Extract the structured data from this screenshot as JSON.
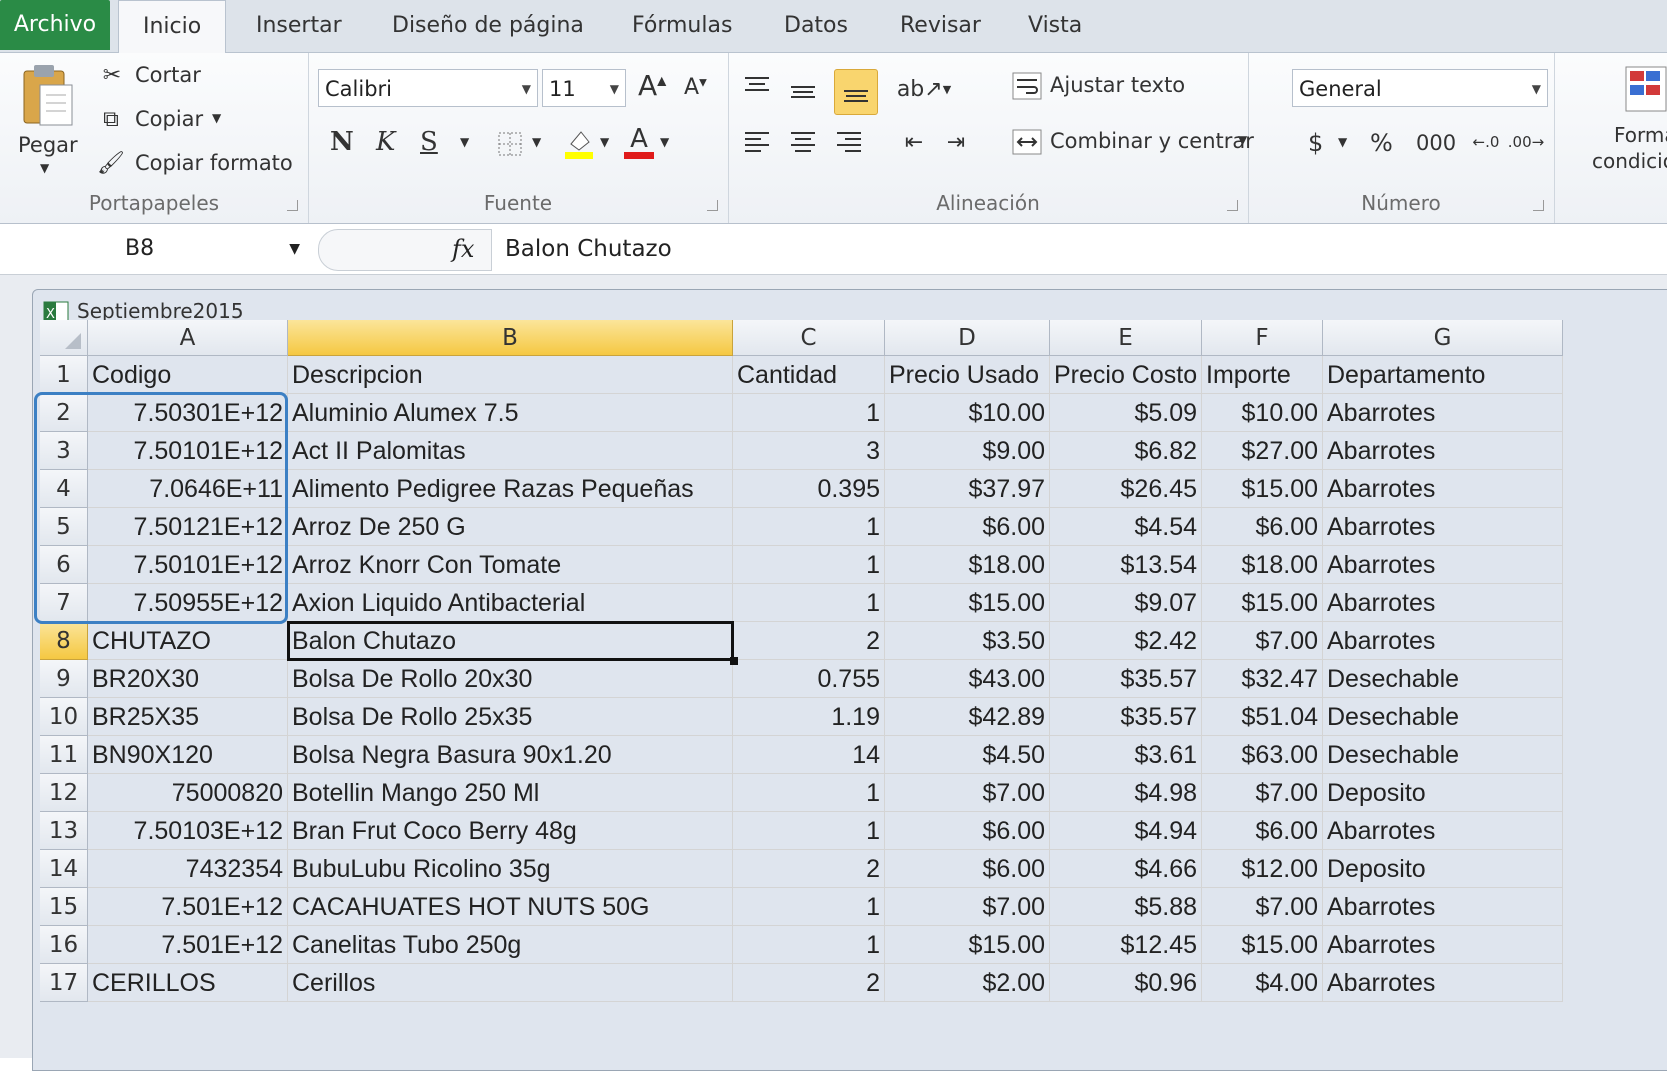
{
  "tabs": {
    "file": "Archivo",
    "items": [
      "Inicio",
      "Insertar",
      "Diseño de página",
      "Fórmulas",
      "Datos",
      "Revisar",
      "Vista"
    ]
  },
  "ribbon": {
    "clipboard": {
      "paste": "Pegar",
      "cut": "Cortar",
      "copy": "Copiar",
      "format_painter": "Copiar formato",
      "label": "Portapapeles"
    },
    "font": {
      "name": "Calibri",
      "size": "11",
      "bold": "N",
      "italic": "K",
      "underline": "S",
      "grow": "A",
      "shrink": "A",
      "font_color": "A",
      "label": "Fuente"
    },
    "alignment": {
      "wrap": "Ajustar texto",
      "merge": "Combinar y centrar",
      "label": "Alineación"
    },
    "number": {
      "format": "General",
      "currency": "$",
      "percent": "%",
      "thousands": "000",
      "label": "Número"
    },
    "styles": {
      "cond_format_1": "Forma",
      "cond_format_2": "condicio"
    }
  },
  "formula_bar": {
    "name_box": "B8",
    "fx": "fx",
    "value": "Balon Chutazo"
  },
  "workbook": {
    "title": "Septiembre2015"
  },
  "sheet": {
    "columns": [
      "A",
      "B",
      "C",
      "D",
      "E",
      "F",
      "G"
    ],
    "selected_column": "B",
    "selected_row": "8",
    "rows": [
      {
        "n": "1",
        "a": "Codigo",
        "b": "Descripcion",
        "c": "Cantidad",
        "d": "Precio Usado",
        "e": "Precio Costo",
        "f": "Importe",
        "g": "Departamento"
      },
      {
        "n": "2",
        "a": "7.50301E+12",
        "b": " Aluminio Alumex 7.5",
        "c": "1",
        "d": "$10.00",
        "e": "$5.09",
        "f": "$10.00",
        "g": "Abarrotes"
      },
      {
        "n": "3",
        "a": "7.50101E+12",
        "b": "Act II Palomitas",
        "c": "3",
        "d": "$9.00",
        "e": "$6.82",
        "f": "$27.00",
        "g": "Abarrotes"
      },
      {
        "n": "4",
        "a": "7.0646E+11",
        "b": "Alimento  Pedigree Razas Pequeñas",
        "c": "0.395",
        "d": "$37.97",
        "e": "$26.45",
        "f": "$15.00",
        "g": "Abarrotes"
      },
      {
        "n": "5",
        "a": "7.50121E+12",
        "b": "Arroz De 250 G",
        "c": "1",
        "d": "$6.00",
        "e": "$4.54",
        "f": "$6.00",
        "g": "Abarrotes"
      },
      {
        "n": "6",
        "a": "7.50101E+12",
        "b": "Arroz Knorr Con Tomate",
        "c": "1",
        "d": "$18.00",
        "e": "$13.54",
        "f": "$18.00",
        "g": "Abarrotes"
      },
      {
        "n": "7",
        "a": "7.50955E+12",
        "b": "Axion Liquido Antibacterial",
        "c": "1",
        "d": "$15.00",
        "e": "$9.07",
        "f": "$15.00",
        "g": "Abarrotes"
      },
      {
        "n": "8",
        "a": "CHUTAZO",
        "b": "Balon Chutazo",
        "c": "2",
        "d": "$3.50",
        "e": "$2.42",
        "f": "$7.00",
        "g": "Abarrotes"
      },
      {
        "n": "9",
        "a": "BR20X30",
        "b": "Bolsa De Rollo 20x30",
        "c": "0.755",
        "d": "$43.00",
        "e": "$35.57",
        "f": "$32.47",
        "g": "Desechable"
      },
      {
        "n": "10",
        "a": "BR25X35",
        "b": "Bolsa De Rollo 25x35",
        "c": "1.19",
        "d": "$42.89",
        "e": "$35.57",
        "f": "$51.04",
        "g": "Desechable"
      },
      {
        "n": "11",
        "a": "BN90X120",
        "b": "Bolsa Negra Basura 90x1.20",
        "c": "14",
        "d": "$4.50",
        "e": "$3.61",
        "f": "$63.00",
        "g": "Desechable"
      },
      {
        "n": "12",
        "a": "75000820",
        "b": "Botellin Mango 250 Ml",
        "c": "1",
        "d": "$7.00",
        "e": "$4.98",
        "f": "$7.00",
        "g": "Deposito"
      },
      {
        "n": "13",
        "a": "7.50103E+12",
        "b": "Bran Frut Coco Berry 48g",
        "c": "1",
        "d": "$6.00",
        "e": "$4.94",
        "f": "$6.00",
        "g": "Abarrotes"
      },
      {
        "n": "14",
        "a": "7432354",
        "b": "BubuLubu Ricolino 35g",
        "c": "2",
        "d": "$6.00",
        "e": "$4.66",
        "f": "$12.00",
        "g": "Deposito"
      },
      {
        "n": "15",
        "a": "7.501E+12",
        "b": "CACAHUATES HOT NUTS 50G",
        "c": "1",
        "d": "$7.00",
        "e": "$5.88",
        "f": "$7.00",
        "g": "Abarrotes"
      },
      {
        "n": "16",
        "a": "7.501E+12",
        "b": "Canelitas Tubo 250g",
        "c": "1",
        "d": "$15.00",
        "e": "$12.45",
        "f": "$15.00",
        "g": "Abarrotes"
      },
      {
        "n": "17",
        "a": "CERILLOS",
        "b": "Cerillos",
        "c": "2",
        "d": "$2.00",
        "e": "$0.96",
        "f": "$4.00",
        "g": "Abarrotes"
      }
    ]
  }
}
